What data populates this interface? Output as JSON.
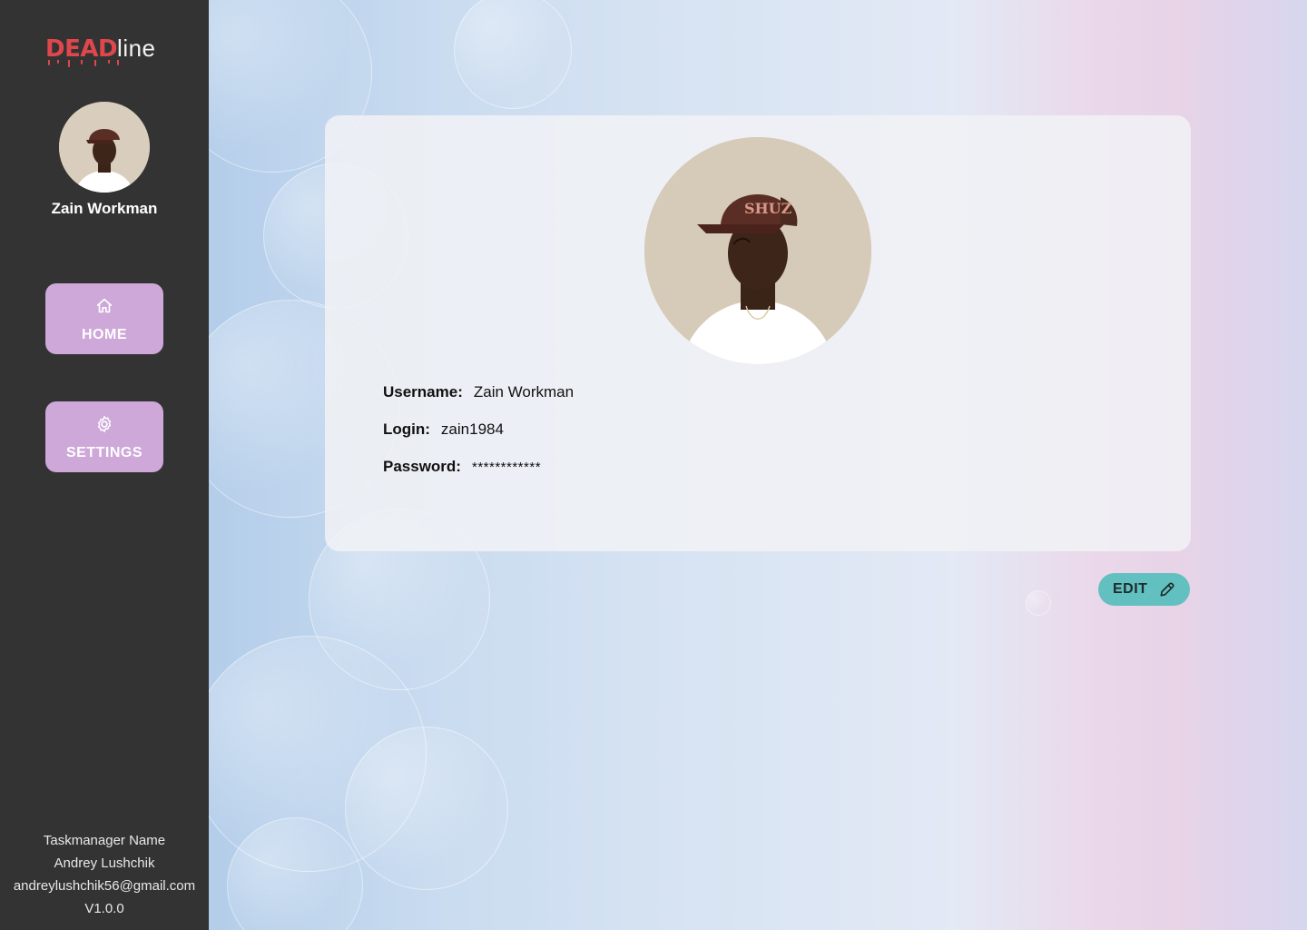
{
  "brand": {
    "part1": "DEAD",
    "part2": "line",
    "accent": "#e0474c"
  },
  "user": {
    "name": "Zain Workman"
  },
  "nav": {
    "items": [
      {
        "label": "HOME",
        "icon": "home-icon"
      },
      {
        "label": "SETTINGS",
        "icon": "gear-icon"
      }
    ],
    "color": "#cda8d9"
  },
  "profile": {
    "username_label": "Username:",
    "username_value": "Zain Workman",
    "login_label": "Login:",
    "login_value": "zain1984",
    "password_label": "Password:",
    "password_value": "************"
  },
  "edit": {
    "label": "EDIT",
    "icon": "pencil-icon",
    "color": "#63c0c0"
  },
  "footer": {
    "app_name": "Taskmanager Name",
    "author": "Andrey Lushchik",
    "email": "andreylushchik56@gmail.com",
    "version": "V1.0.0"
  },
  "colors": {
    "sidebar": "#333333"
  }
}
